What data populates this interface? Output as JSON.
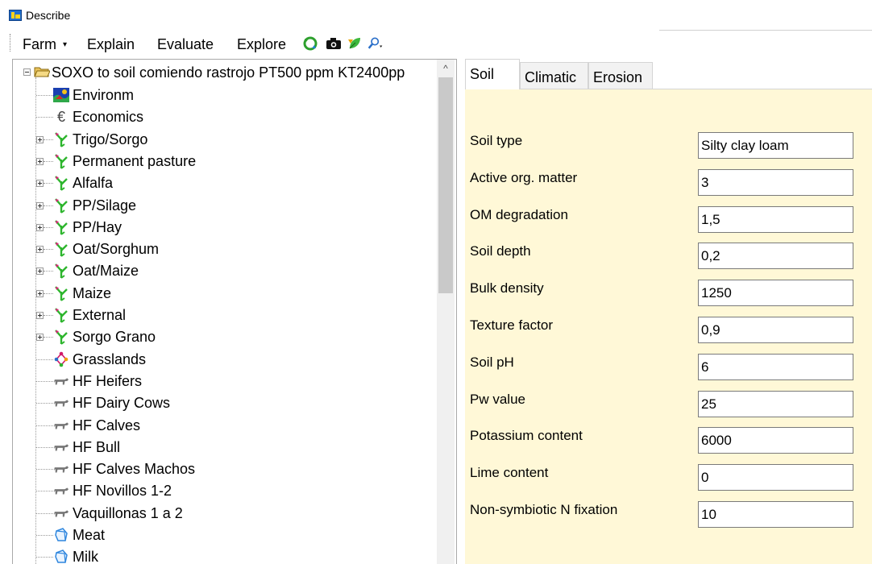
{
  "window": {
    "title": "Describe"
  },
  "menu": {
    "items": [
      {
        "label": "Farm",
        "has_dropdown": true
      },
      {
        "label": "Explain"
      },
      {
        "label": "Evaluate"
      },
      {
        "label": "Explore"
      }
    ],
    "toolbar_icons": [
      "recycle-arrows-icon",
      "camera-icon",
      "leaf-refresh-icon",
      "search-dropdown-icon"
    ]
  },
  "tree": {
    "root": {
      "label": "SOXO to soil comiendo rastrojo PT500 ppm KT2400pp",
      "icon": "folder-open-icon"
    },
    "items": [
      {
        "label": "Environm",
        "icon": "environment-icon",
        "expandable": false
      },
      {
        "label": "Economics",
        "icon": "euro-icon",
        "expandable": false
      },
      {
        "label": "Trigo/Sorgo",
        "icon": "crop-icon",
        "expandable": true
      },
      {
        "label": "Permanent pasture",
        "icon": "crop-icon",
        "expandable": true
      },
      {
        "label": "Alfalfa",
        "icon": "crop-icon",
        "expandable": true
      },
      {
        "label": "PP/Silage",
        "icon": "crop-icon",
        "expandable": true
      },
      {
        "label": "PP/Hay",
        "icon": "crop-icon",
        "expandable": true
      },
      {
        "label": "Oat/Sorghum",
        "icon": "crop-icon",
        "expandable": true
      },
      {
        "label": "Oat/Maize",
        "icon": "crop-icon",
        "expandable": true
      },
      {
        "label": "Maize",
        "icon": "crop-icon",
        "expandable": true
      },
      {
        "label": "External",
        "icon": "crop-icon",
        "expandable": true
      },
      {
        "label": "Sorgo Grano",
        "icon": "crop-icon",
        "expandable": true
      },
      {
        "label": "Grasslands",
        "icon": "network-icon",
        "expandable": false
      },
      {
        "label": "HF Heifers",
        "icon": "cow-icon",
        "expandable": false
      },
      {
        "label": "HF Dairy Cows",
        "icon": "cow-icon",
        "expandable": false
      },
      {
        "label": "HF Calves",
        "icon": "cow-icon",
        "expandable": false
      },
      {
        "label": "HF Bull",
        "icon": "cow-icon",
        "expandable": false
      },
      {
        "label": "HF Calves Machos",
        "icon": "cow-icon",
        "expandable": false
      },
      {
        "label": "HF Novillos 1-2",
        "icon": "cow-icon",
        "expandable": false
      },
      {
        "label": "Vaquillonas 1 a 2",
        "icon": "cow-icon",
        "expandable": false
      },
      {
        "label": "Meat",
        "icon": "product-icon",
        "expandable": false
      },
      {
        "label": "Milk",
        "icon": "product-icon",
        "expandable": false
      }
    ]
  },
  "tabs": [
    {
      "label": "Soil",
      "active": true
    },
    {
      "label": "Climatic",
      "active": false
    },
    {
      "label": "Erosion",
      "active": false
    }
  ],
  "soil_fields": [
    {
      "label": "Soil type",
      "value": "Silty clay loam"
    },
    {
      "label": "Active org. matter",
      "value": "3"
    },
    {
      "label": "OM degradation",
      "value": "1,5"
    },
    {
      "label": "Soil depth",
      "value": "0,2"
    },
    {
      "label": "Bulk density",
      "value": "1250"
    },
    {
      "label": "Texture factor",
      "value": "0,9"
    },
    {
      "label": "Soil pH",
      "value": "6"
    },
    {
      "label": "Pw value",
      "value": "25"
    },
    {
      "label": "Potassium content",
      "value": "6000"
    },
    {
      "label": "Lime content",
      "value": "0"
    },
    {
      "label": "Non-symbiotic N fixation",
      "value": "10"
    }
  ],
  "colors": {
    "panel_background": "#fff8d7",
    "crop_icon": "#2db52d",
    "crop_icon_accent": "#e0207a",
    "cow_icon": "#7a7a7a",
    "product_icon": "#3a8fd8"
  }
}
